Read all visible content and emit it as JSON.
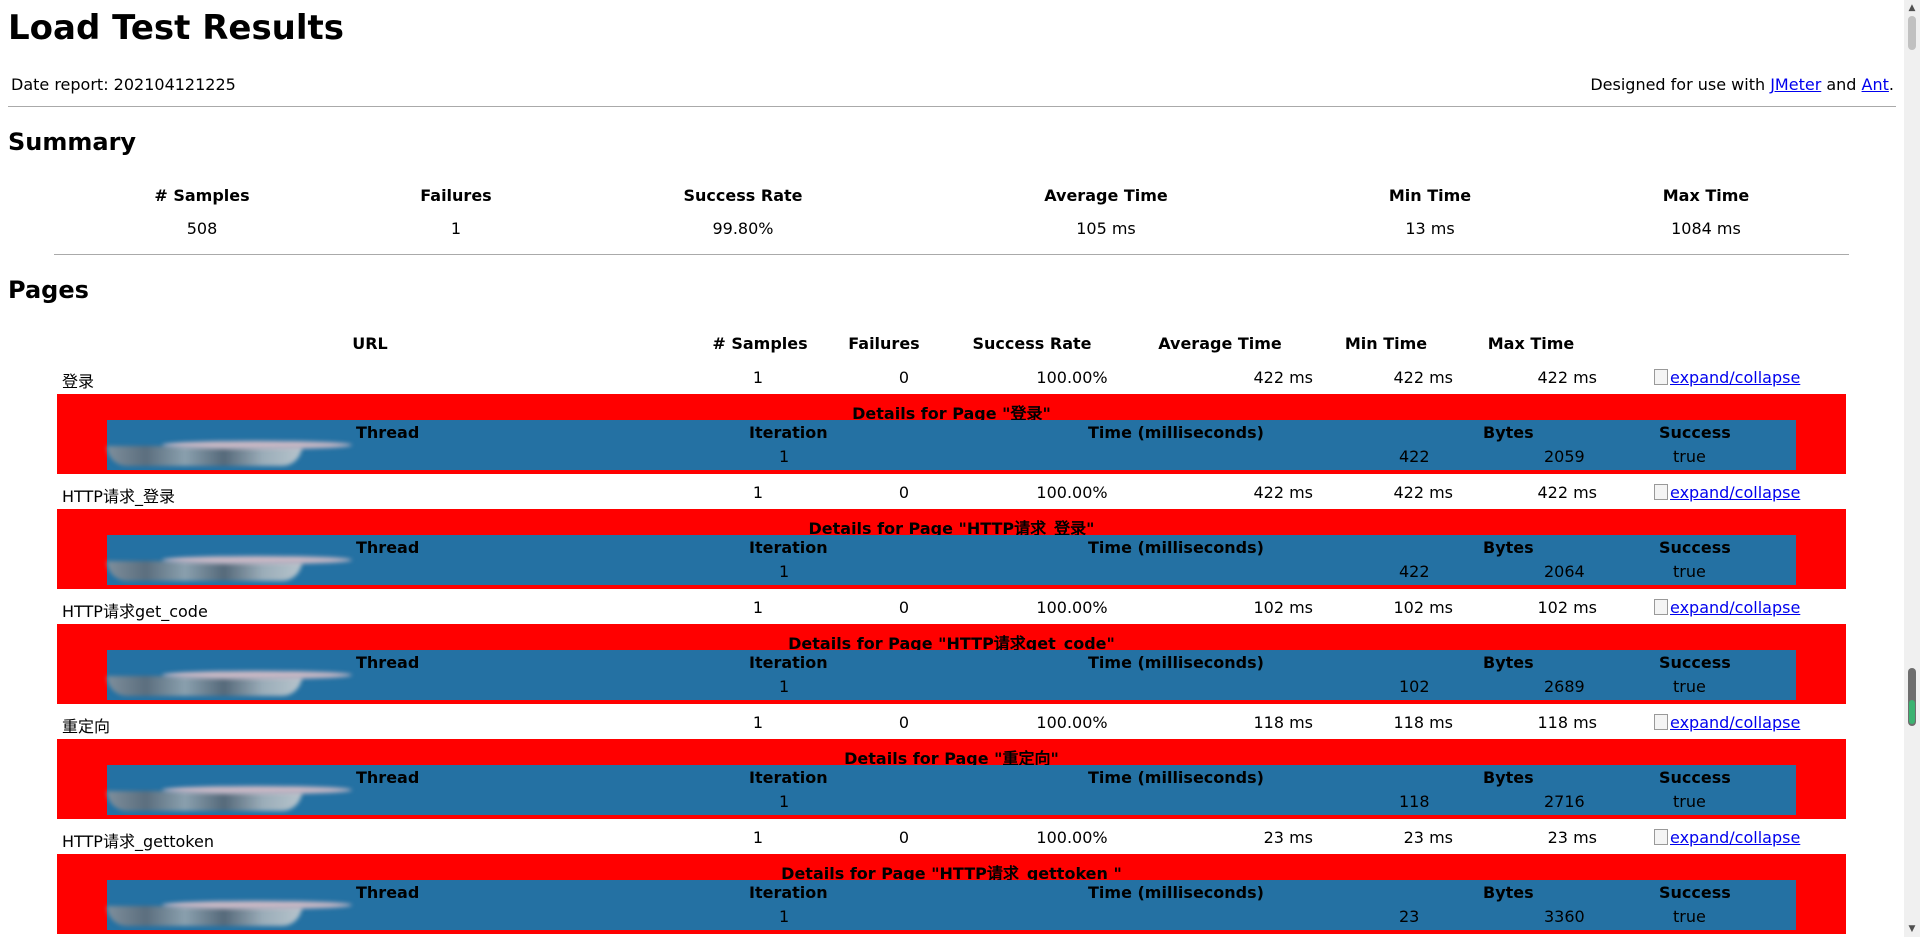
{
  "title": "Load Test Results",
  "date_report": "Date report: 202104121225",
  "designed": {
    "prefix": "Designed for use with ",
    "link1": "JMeter",
    "mid": " and ",
    "link2": "Ant",
    "suffix": "."
  },
  "summary": {
    "heading": "Summary",
    "columns": [
      "# Samples",
      "Failures",
      "Success Rate",
      "Average Time",
      "Min Time",
      "Max Time"
    ],
    "values": [
      "508",
      "1",
      "99.80%",
      "105 ms",
      "13 ms",
      "1084 ms"
    ]
  },
  "pages": {
    "heading": "Pages",
    "columns": [
      "URL",
      "# Samples",
      "Failures",
      "Success Rate",
      "Average Time",
      "Min Time",
      "Max Time"
    ],
    "expand_label": "expand/collapse",
    "detail_columns": [
      "Thread",
      "Iteration",
      "Time (milliseconds)",
      "Bytes",
      "Success"
    ],
    "rows": [
      {
        "url": "登录",
        "samples": "1",
        "failures": "0",
        "rate": "100.00%",
        "avg": "422 ms",
        "min": "422 ms",
        "max": "422 ms",
        "detail_title": "Details for Page \"登录\"",
        "iteration": "1",
        "time": "422",
        "bytes": "2059",
        "success": "true"
      },
      {
        "url": "HTTP请求_登录",
        "samples": "1",
        "failures": "0",
        "rate": "100.00%",
        "avg": "422 ms",
        "min": "422 ms",
        "max": "422 ms",
        "detail_title": "Details for Page \"HTTP请求_登录\"",
        "iteration": "1",
        "time": "422",
        "bytes": "2064",
        "success": "true"
      },
      {
        "url": "HTTP请求get_code",
        "samples": "1",
        "failures": "0",
        "rate": "100.00%",
        "avg": "102 ms",
        "min": "102 ms",
        "max": "102 ms",
        "detail_title": "Details for Page \"HTTP请求get_code\"",
        "iteration": "1",
        "time": "102",
        "bytes": "2689",
        "success": "true"
      },
      {
        "url": "重定向",
        "samples": "1",
        "failures": "0",
        "rate": "100.00%",
        "avg": "118 ms",
        "min": "118 ms",
        "max": "118 ms",
        "detail_title": "Details for Page \"重定向\"",
        "iteration": "1",
        "time": "118",
        "bytes": "2716",
        "success": "true"
      },
      {
        "url": "HTTP请求_gettoken",
        "samples": "1",
        "failures": "0",
        "rate": "100.00%",
        "avg": "23 ms",
        "min": "23 ms",
        "max": "23 ms",
        "detail_title": "Details for Page \"HTTP请求_gettoken \"",
        "iteration": "1",
        "time": "23",
        "bytes": "3360",
        "success": "true"
      }
    ]
  }
}
